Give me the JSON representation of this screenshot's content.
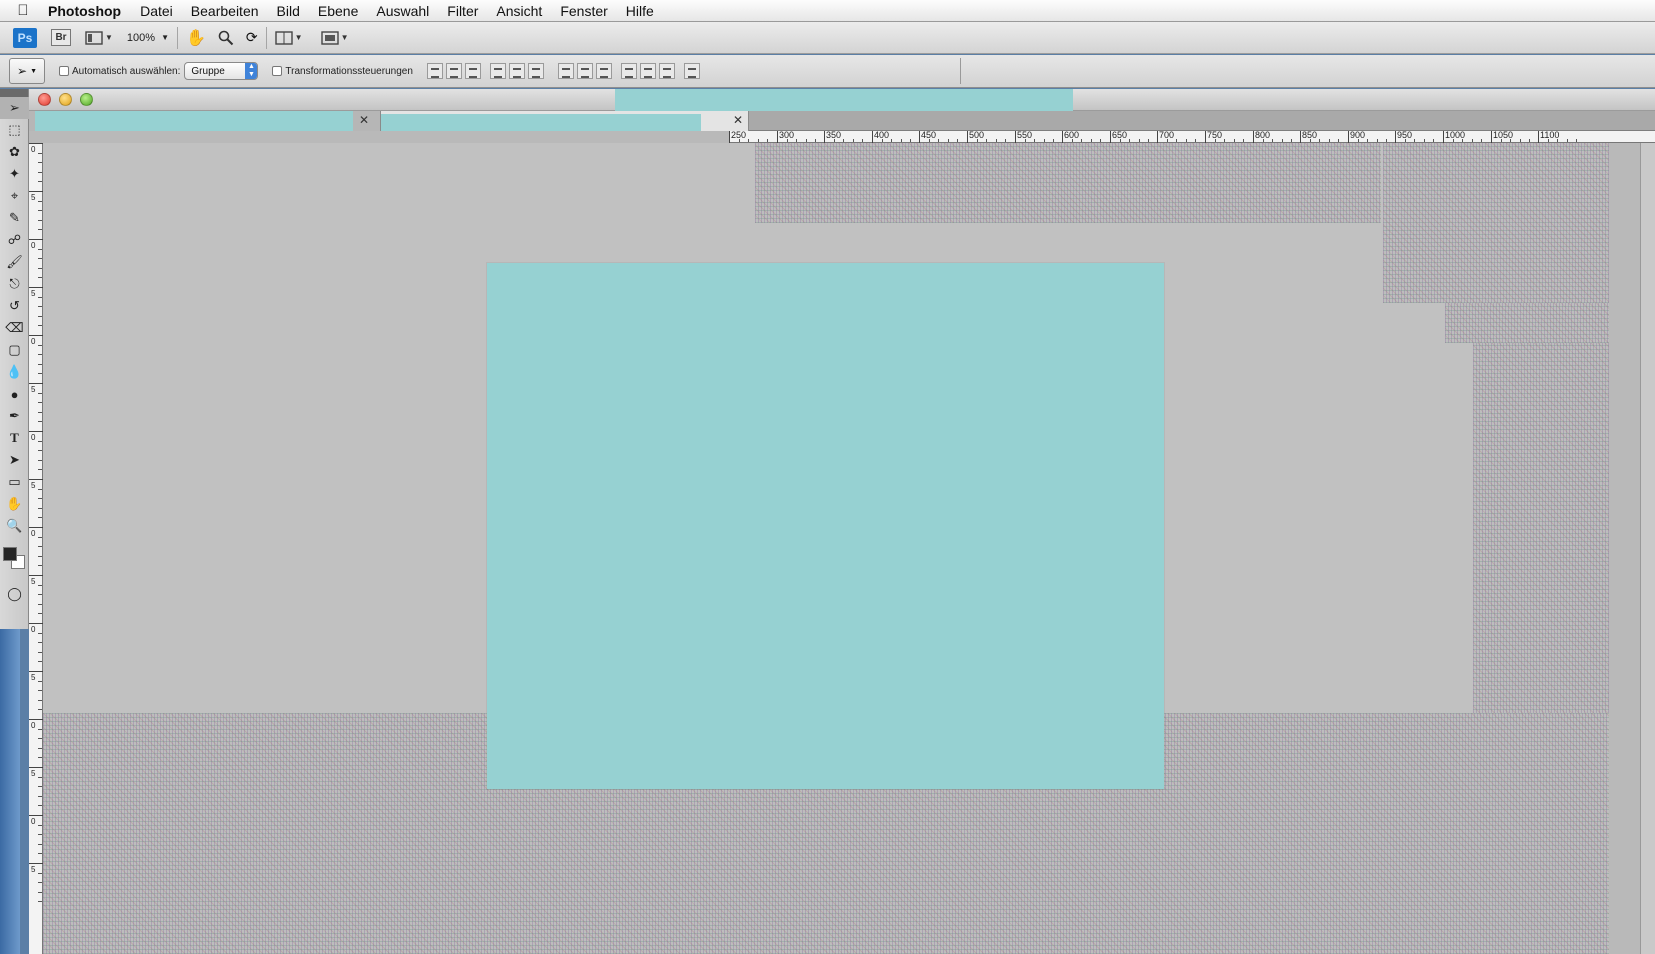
{
  "menubar": {
    "apple_icon": "apple-logo-icon",
    "app_name": "Photoshop",
    "items": [
      "Datei",
      "Bearbeiten",
      "Bild",
      "Ebene",
      "Auswahl",
      "Filter",
      "Ansicht",
      "Fenster",
      "Hilfe"
    ]
  },
  "appbar": {
    "ps_logo": "Ps",
    "bridge_logo": "Br",
    "zoom": "100%",
    "icons": [
      "screen-mode-icon",
      "hand-icon",
      "zoom-icon",
      "rotate-view-icon",
      "arrange-documents-icon",
      "screen-mode-icon"
    ]
  },
  "options": {
    "auto_select_label": "Automatisch auswählen:",
    "auto_select_checked": false,
    "auto_select_value": "Gruppe",
    "transform_label": "Transformationssteuerungen",
    "transform_checked": false
  },
  "tools": [
    "move-tool",
    "marquee-tool",
    "lasso-tool",
    "magic-wand-tool",
    "crop-tool",
    "eyedropper-tool",
    "healing-brush-tool",
    "brush-tool",
    "clone-stamp-tool",
    "history-brush-tool",
    "eraser-tool",
    "gradient-tool",
    "blur-tool",
    "dodge-tool",
    "pen-tool",
    "type-tool",
    "path-selection-tool",
    "shape-tool",
    "hand-tool",
    "zoom-tool"
  ],
  "colors": {
    "foreground": "#262626",
    "background": "#ffffff",
    "canvas_fill": "#96d1d2",
    "redacted_fill": "#96d1d2"
  },
  "ruler": {
    "h_labels": [
      "250",
      "300",
      "350",
      "400",
      "450",
      "500",
      "550",
      "600",
      "650",
      "700",
      "750",
      "800",
      "850",
      "900",
      "950",
      "1000",
      "1050",
      "1100"
    ],
    "v_labels": [
      "0",
      "5",
      "0",
      "5",
      "0",
      "5",
      "0",
      "5",
      "0",
      "5",
      "0",
      "5",
      "0",
      "5",
      "0",
      "5"
    ]
  }
}
